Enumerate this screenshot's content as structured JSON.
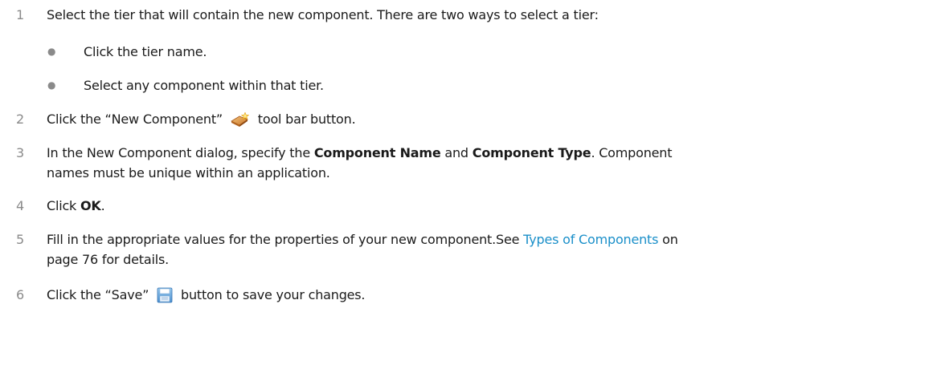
{
  "steps": [
    {
      "num": "1",
      "text": "Select the tier that will contain the new component. There are two ways to select a tier:",
      "bullets": [
        "Click the tier name.",
        "Select any component within that tier."
      ]
    },
    {
      "num": "2",
      "before": "Click the “New Component”",
      "after": "tool bar button.",
      "icon": "new-component-icon"
    },
    {
      "num": "3",
      "before": "In the New Component dialog, specify the",
      "bold1": "Component Name",
      "mid": "and",
      "bold2": "Component Type",
      "after": ". Component",
      "line2": "names must be unique within an application."
    },
    {
      "num": "4",
      "before": "Click",
      "bold": "OK",
      "after": "."
    },
    {
      "num": "5",
      "before": "Fill in the appropriate values for the properties of your new component.See",
      "link": "Types of Components",
      "after": "on",
      "line2": "page 76 for details."
    },
    {
      "num": "6",
      "before": "Click the “Save”",
      "after": "button to save your changes.",
      "icon": "save-icon"
    }
  ],
  "colors": {
    "text": "#1a1a1a",
    "number": "#8a8a8a",
    "link": "#1a8fc9"
  }
}
